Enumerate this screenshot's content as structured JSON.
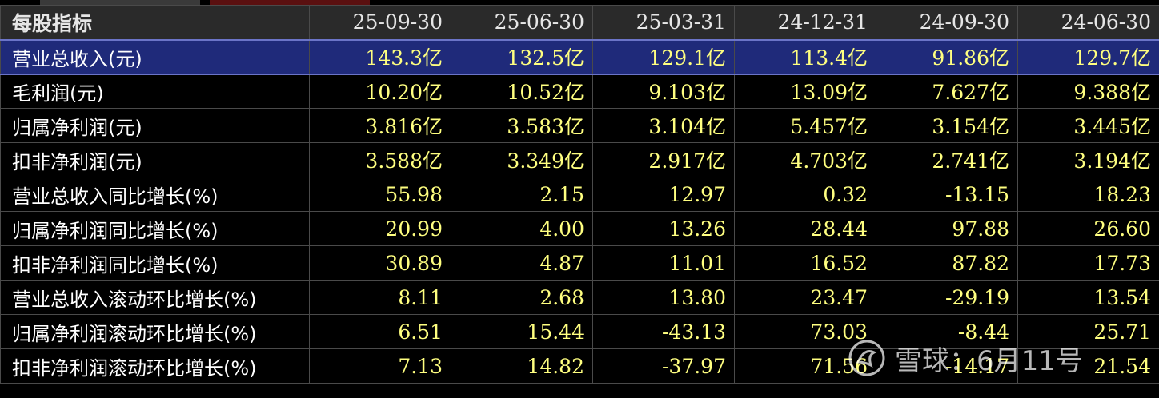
{
  "table": {
    "header": [
      "每股指标",
      "25-09-30",
      "25-06-30",
      "25-03-31",
      "24-12-31",
      "24-09-30",
      "24-06-30"
    ],
    "rows": [
      {
        "label": "营业总收入(元)",
        "values": [
          "143.3亿",
          "132.5亿",
          "129.1亿",
          "113.4亿",
          "91.86亿",
          "129.7亿"
        ],
        "selected": true
      },
      {
        "label": "毛利润(元)",
        "values": [
          "10.20亿",
          "10.52亿",
          "9.103亿",
          "13.09亿",
          "7.627亿",
          "9.388亿"
        ]
      },
      {
        "label": "归属净利润(元)",
        "values": [
          "3.816亿",
          "3.583亿",
          "3.104亿",
          "5.457亿",
          "3.154亿",
          "3.445亿"
        ]
      },
      {
        "label": "扣非净利润(元)",
        "values": [
          "3.588亿",
          "3.349亿",
          "2.917亿",
          "4.703亿",
          "2.741亿",
          "3.194亿"
        ]
      },
      {
        "label": "营业总收入同比增长(%)",
        "values": [
          "55.98",
          "2.15",
          "12.97",
          "0.32",
          "-13.15",
          "18.23"
        ]
      },
      {
        "label": "归属净利润同比增长(%)",
        "values": [
          "20.99",
          "4.00",
          "13.26",
          "28.44",
          "97.88",
          "26.60"
        ]
      },
      {
        "label": "扣非净利润同比增长(%)",
        "values": [
          "30.89",
          "4.87",
          "11.01",
          "16.52",
          "87.82",
          "17.73"
        ]
      },
      {
        "label": "营业总收入滚动环比增长(%)",
        "values": [
          "8.11",
          "2.68",
          "13.80",
          "23.47",
          "-29.19",
          "13.54"
        ]
      },
      {
        "label": "归属净利润滚动环比增长(%)",
        "values": [
          "6.51",
          "15.44",
          "-43.13",
          "73.03",
          "-8.44",
          "25.71"
        ]
      },
      {
        "label": "扣非净利润滚动环比增长(%)",
        "values": [
          "7.13",
          "14.82",
          "-37.97",
          "71.56",
          "-14.17",
          "21.54"
        ]
      }
    ]
  },
  "watermark": {
    "text": "雪球：6月11号",
    "icon": "snowball-logo-icon"
  },
  "colors": {
    "background": "#000000",
    "header_bg": "#2a2a2a",
    "value_text": "#ffff80",
    "label_text": "#ffffff",
    "selected_row": "#1f2a7a",
    "grid": "#4a4a4a"
  }
}
